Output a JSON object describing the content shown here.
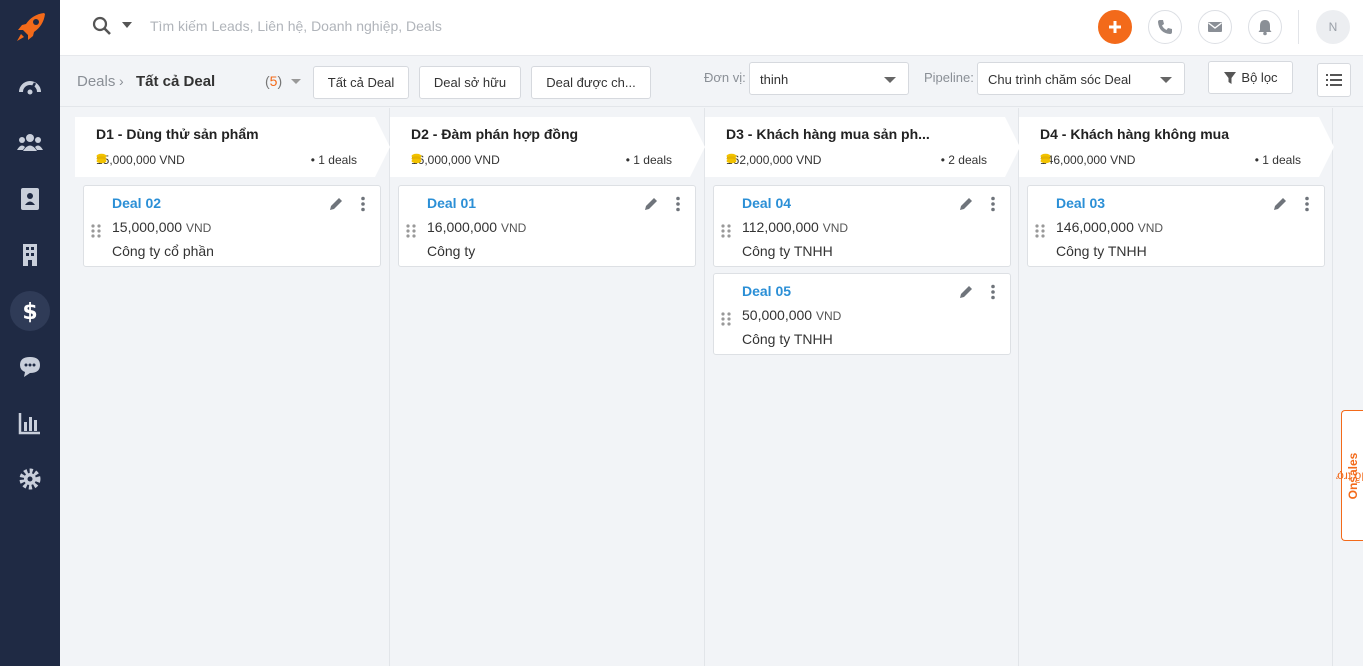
{
  "search": {
    "placeholder": "Tìm kiếm Leads, Liên hệ, Doanh nghiệp, Deals"
  },
  "user": {
    "initial": "N"
  },
  "breadcrumb": {
    "root": "Deals",
    "separator": "›",
    "current": "Tất cả Deal",
    "count": "5"
  },
  "filters": {
    "all": "Tất cả Deal",
    "owned": "Deal sở hữu",
    "cared": "Deal được ch..."
  },
  "unit": {
    "label": "Đơn vị:",
    "value": "thinh"
  },
  "pipeline": {
    "label": "Pipeline:",
    "value": "Chu trình chăm sóc Deal"
  },
  "filter_button": {
    "label": "Bộ lọc"
  },
  "columns": [
    {
      "title": "D1 - Dùng thử sản phẩm",
      "amount": "15,000,000 VND",
      "count": "• 1 deals",
      "cards": [
        {
          "title": "Deal 02",
          "amount": "15,000,000",
          "currency": "VND",
          "company": "Công ty cổ phần"
        }
      ]
    },
    {
      "title": "D2 - Đàm phán hợp đồng",
      "amount": "16,000,000 VND",
      "count": "• 1 deals",
      "cards": [
        {
          "title": "Deal 01",
          "amount": "16,000,000",
          "currency": "VND",
          "company": "Công ty"
        }
      ]
    },
    {
      "title": "D3 - Khách hàng mua sản ph...",
      "amount": "162,000,000 VND",
      "count": "• 2 deals",
      "cards": [
        {
          "title": "Deal 04",
          "amount": "112,000,000",
          "currency": "VND",
          "company": "Công ty TNHH"
        },
        {
          "title": "Deal 05",
          "amount": "50,000,000",
          "currency": "VND",
          "company": "Công ty TNHH"
        }
      ]
    },
    {
      "title": "D4 - Khách hàng không mua",
      "amount": "146,000,000 VND",
      "count": "• 1 deals",
      "cards": [
        {
          "title": "Deal 03",
          "amount": "146,000,000",
          "currency": "VND",
          "company": "Công ty TNHH"
        }
      ]
    }
  ],
  "support": {
    "prefix": "Hỗ trợ",
    "brand": "Onsales"
  },
  "colors": {
    "accent": "#f36a1a",
    "sidebar": "#1f2a44",
    "link": "#2b8fd6"
  },
  "icons": [
    "rocket-logo-icon",
    "dashboard-icon",
    "users-icon",
    "contacts-icon",
    "building-icon",
    "dollar-icon",
    "chat-icon",
    "report-icon",
    "settings-icon",
    "search-icon",
    "plus-icon",
    "phone-icon",
    "mail-icon",
    "bell-icon",
    "filter-icon",
    "list-icon",
    "edit-icon",
    "more-icon",
    "drag-icon",
    "coin-icon"
  ]
}
